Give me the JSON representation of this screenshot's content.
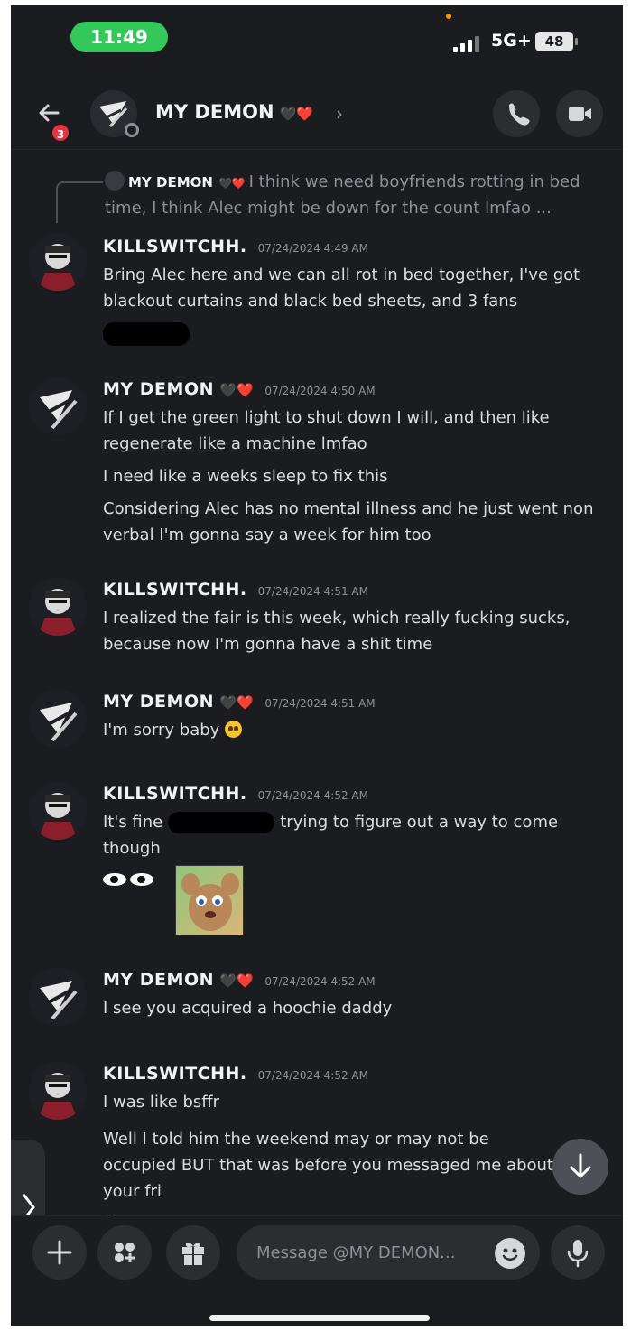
{
  "status_bar": {
    "time": "11:49",
    "network": "5G+",
    "battery": "48"
  },
  "header": {
    "badge": "3",
    "title": "MY DEMON",
    "chevron": "›"
  },
  "reply_preview": {
    "author": "MY DEMON",
    "text": "I think we need boyfriends rotting in bed time, I think Alec might be down for the count lmfao ..."
  },
  "messages": [
    {
      "author": "KILLSWITCHH.",
      "timestamp": "07/24/2024 4:49 AM",
      "lines": [
        "Bring Alec here and we can all rot in bed together, I've got blackout curtains and black bed sheets, and 3 fans"
      ]
    },
    {
      "author": "MY DEMON",
      "timestamp": "07/24/2024 4:50 AM",
      "lines": [
        "If I get the green light to shut down I will, and then like regenerate like a machine lmfao",
        "I need like a weeks sleep to fix this",
        "Considering Alec has no mental illness and he just went non verbal I'm gonna say a week for him too"
      ]
    },
    {
      "author": "KILLSWITCHH.",
      "timestamp": "07/24/2024 4:51 AM",
      "lines": [
        "I realized the fair is this week, which really fucking sucks, because now I'm gonna have a shit time"
      ]
    },
    {
      "author": "MY DEMON",
      "timestamp": "07/24/2024 4:51 AM",
      "lines": [
        "I'm sorry baby"
      ]
    },
    {
      "author": "KILLSWITCHH.",
      "timestamp": "07/24/2024 4:52 AM",
      "lines": [
        "It's fine",
        "trying to figure out a way to come though"
      ]
    },
    {
      "author": "MY DEMON",
      "timestamp": "07/24/2024 4:52 AM",
      "lines": [
        "I see you acquired a hoochie daddy"
      ]
    },
    {
      "author": "KILLSWITCHH.",
      "timestamp": "07/24/2024 4:52 AM",
      "lines": [
        "I was like bsffr",
        "Well I told him the weekend may or may not be occupied BUT that was before you messaged me about your fri"
      ]
    }
  ],
  "composer": {
    "placeholder": "Message @MY DEMON..."
  },
  "icons": {
    "back": "arrow-left-icon",
    "call": "phone-icon",
    "video": "video-camera-icon",
    "add": "plus-icon",
    "apps": "apps-icon",
    "gift": "gift-icon",
    "emoji": "emoji-icon",
    "mic": "microphone-icon",
    "scroll": "arrow-down-icon"
  },
  "colors": {
    "background": "#1b1c20",
    "time_pill": "#34c759",
    "badge": "#e5333f",
    "accent_heart": "#e0394a"
  }
}
